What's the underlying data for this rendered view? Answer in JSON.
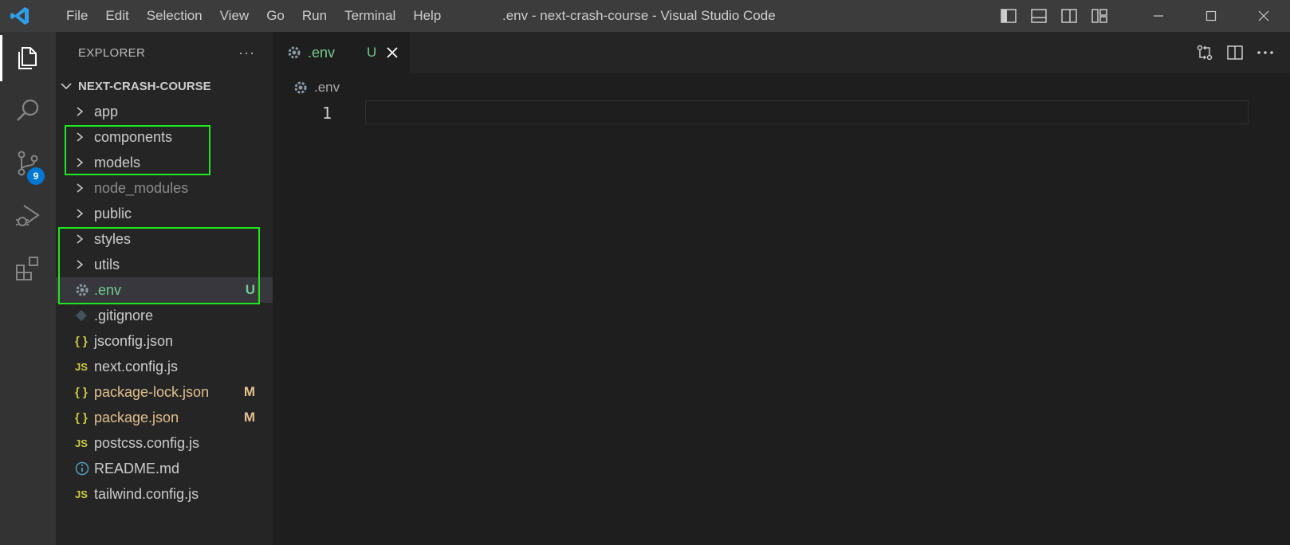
{
  "titlebar": {
    "menu": [
      "File",
      "Edit",
      "Selection",
      "View",
      "Go",
      "Run",
      "Terminal",
      "Help"
    ],
    "window_title": ".env - next-crash-course - Visual Studio Code"
  },
  "activitybar": {
    "items": [
      "explorer-icon",
      "search-icon",
      "source-control-icon",
      "run-debug-icon",
      "extensions-icon"
    ],
    "source_control_badge": "9"
  },
  "sidebar": {
    "header": "EXPLORER",
    "more": "···",
    "folder": "NEXT-CRASH-COURSE",
    "items": [
      {
        "name": "app",
        "type": "folder",
        "color": "#cccccc",
        "status": ""
      },
      {
        "name": "components",
        "type": "folder",
        "color": "#cccccc",
        "status": ""
      },
      {
        "name": "models",
        "type": "folder",
        "color": "#cccccc",
        "status": ""
      },
      {
        "name": "node_modules",
        "type": "folder",
        "color": "#8c8c8c",
        "status": ""
      },
      {
        "name": "public",
        "type": "folder",
        "color": "#cccccc",
        "status": ""
      },
      {
        "name": "styles",
        "type": "folder",
        "color": "#cccccc",
        "status": ""
      },
      {
        "name": "utils",
        "type": "folder",
        "color": "#cccccc",
        "status": ""
      },
      {
        "name": ".env",
        "type": "gear",
        "color": "#73c991",
        "status": "U"
      },
      {
        "name": ".gitignore",
        "type": "git",
        "color": "#cccccc",
        "status": ""
      },
      {
        "name": "jsconfig.json",
        "type": "json",
        "color": "#cccccc",
        "status": ""
      },
      {
        "name": "next.config.js",
        "type": "js",
        "color": "#cccccc",
        "status": ""
      },
      {
        "name": "package-lock.json",
        "type": "json",
        "color": "#e2c08d",
        "status": "M"
      },
      {
        "name": "package.json",
        "type": "json",
        "color": "#e2c08d",
        "status": "M"
      },
      {
        "name": "postcss.config.js",
        "type": "js",
        "color": "#cccccc",
        "status": ""
      },
      {
        "name": "README.md",
        "type": "info",
        "color": "#cccccc",
        "status": ""
      },
      {
        "name": "tailwind.config.js",
        "type": "js",
        "color": "#cccccc",
        "status": ""
      }
    ]
  },
  "editor": {
    "tab": {
      "label": ".env",
      "status": "U"
    },
    "breadcrumb": ".env",
    "line_numbers": [
      "1"
    ]
  },
  "colors": {
    "untracked": "#73c991",
    "modified": "#e2c08d",
    "highlight": "#1ee81e",
    "accent": "#0078d4"
  }
}
